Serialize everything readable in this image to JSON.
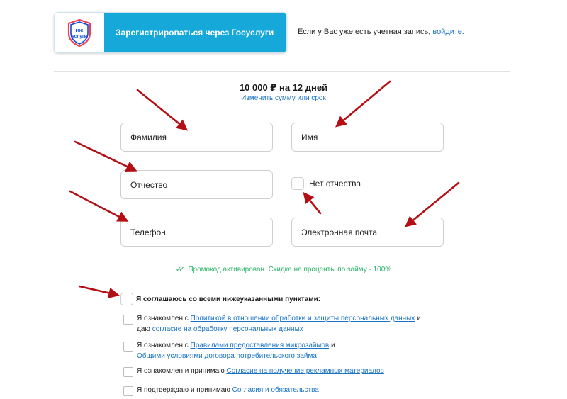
{
  "header": {
    "gos_button_label": "Зарегистрироваться через Госуслуги",
    "gos_logo_top": "гос",
    "gos_logo_bottom": "услуги",
    "login_prefix": "Если у Вас уже есть учетная запись,",
    "login_link": "войдите."
  },
  "loan": {
    "amount_text": "10 000 ₽ на 12 дней",
    "change_link": "Изменить сумму или срок"
  },
  "form": {
    "last_name_placeholder": "Фамилия",
    "first_name_placeholder": "Имя",
    "middle_name_placeholder": "Отчество",
    "no_middle_name_label": "Нет отчества",
    "phone_placeholder": "Телефон",
    "email_placeholder": "Электронная почта"
  },
  "promo": {
    "check_icon": "✓✓",
    "text": "Промокод активирован. Скидка на проценты по займу - 100%"
  },
  "agreements": {
    "agree_all": "Я соглашаюсь со всеми нижеуказанными пунктами:",
    "items": [
      {
        "prefix": "Я ознакомлен с",
        "link1": "Политикой в отношении обработки и защиты персональных данных",
        "mid": "и",
        "line2_prefix": "даю",
        "link2": "согласие на обработку персональных данных"
      },
      {
        "prefix": "Я ознакомлен с",
        "link1": "Правилами предоставления микрозаймов",
        "mid": "и",
        "link2": "Общими условиями договора потребительского займа"
      },
      {
        "prefix": "Я ознакомлен и принимаю",
        "link1": "Согласие на получение рекламных материалов"
      },
      {
        "prefix": "Я подтверждаю и принимаю",
        "link1": "Согласия и обязательства"
      }
    ]
  },
  "colors": {
    "gos_blue": "#15a8d8",
    "link_blue": "#1a73c5",
    "promo_green": "#2db36a",
    "arrow_red": "#b30f14"
  }
}
